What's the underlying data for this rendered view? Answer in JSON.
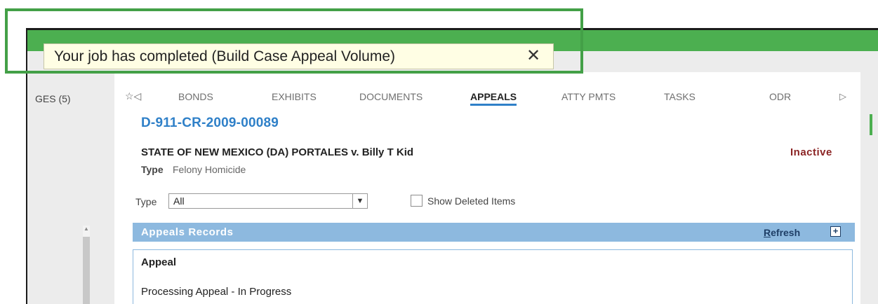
{
  "sidebar": {
    "label": "GES (5)"
  },
  "tabs": {
    "items": [
      {
        "label": "BONDS"
      },
      {
        "label": "EXHIBITS"
      },
      {
        "label": "DOCUMENTS"
      },
      {
        "label": "APPEALS"
      },
      {
        "label": "ATTY PMTS"
      },
      {
        "label": "TASKS"
      },
      {
        "label": "ODR"
      }
    ],
    "active": "APPEALS",
    "fav_icon": "☆◁",
    "next_icon": "▷"
  },
  "case": {
    "number": "D-911-CR-2009-00089",
    "title": "STATE OF NEW MEXICO (DA) PORTALES v. Billy T Kid",
    "type_label": "Type",
    "type_value": "Felony Homicide",
    "status": "Inactive"
  },
  "filter": {
    "type_label": "Type",
    "type_value": "All",
    "show_deleted_label": "Show Deleted Items",
    "show_deleted_checked": false
  },
  "appeals": {
    "header": "Appeals Records",
    "refresh_first": "R",
    "refresh_rest": "efresh",
    "add_icon": "+",
    "record_heading": "Appeal",
    "record_status": "Processing Appeal - In Progress"
  },
  "notification": {
    "text": "Your job has completed (Build Case Appeal Volume)",
    "close_icon": "✕"
  },
  "colors": {
    "accent_green": "#4caf50",
    "link_blue": "#2f80c8",
    "section_blue": "#8db9df",
    "status_red": "#8b2424",
    "toast_bg": "#fffee4"
  }
}
